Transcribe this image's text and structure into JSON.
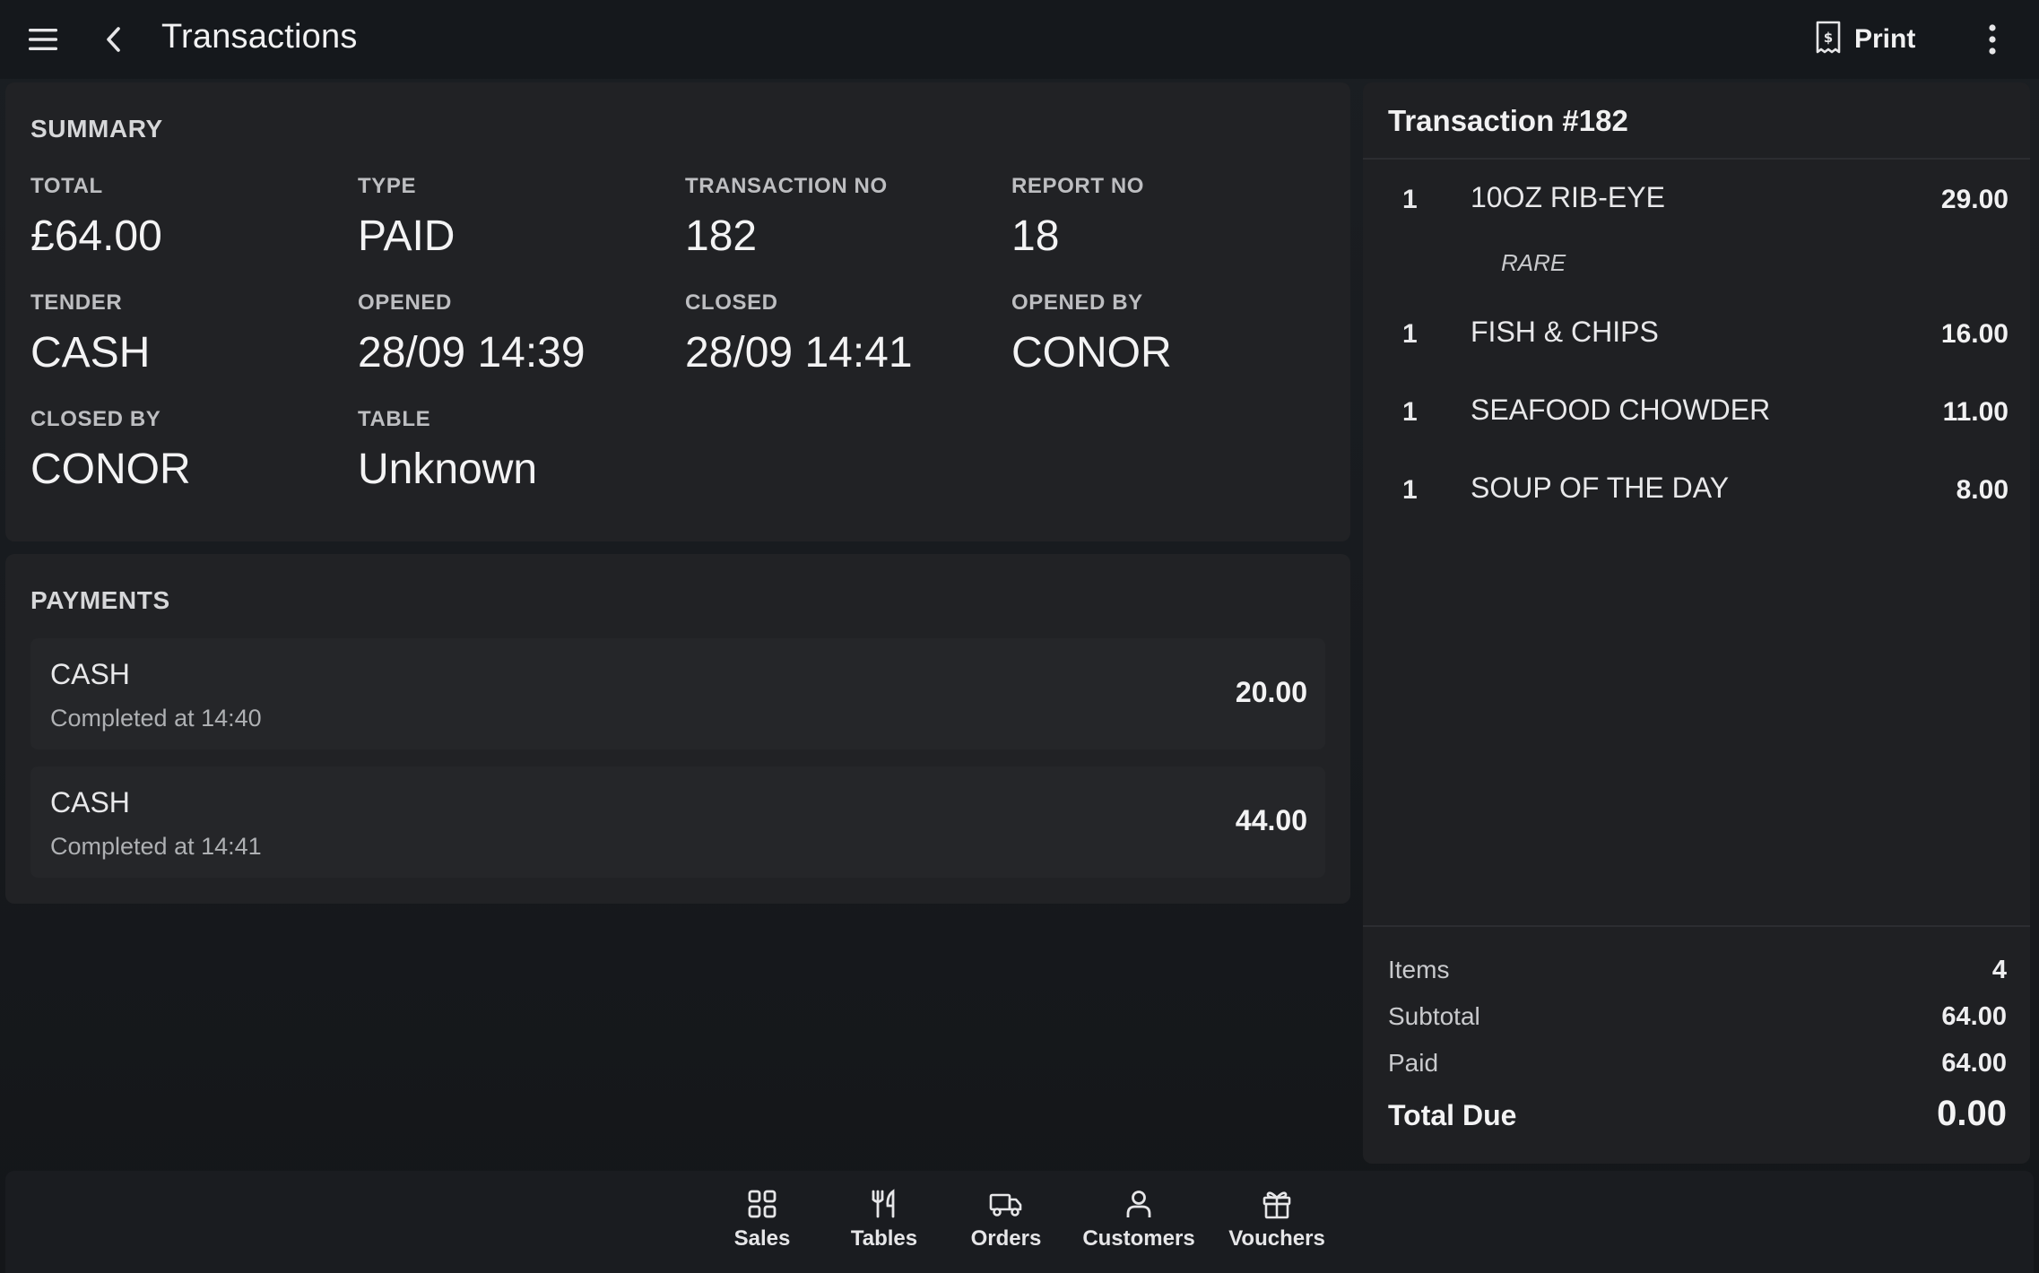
{
  "header": {
    "title": "Transactions",
    "print_label": "Print"
  },
  "summary": {
    "section_title": "SUMMARY",
    "fields": [
      {
        "label": "TOTAL",
        "value": "£64.00"
      },
      {
        "label": "TYPE",
        "value": "PAID"
      },
      {
        "label": "TRANSACTION NO",
        "value": "182"
      },
      {
        "label": "REPORT NO",
        "value": "18"
      },
      {
        "label": "TENDER",
        "value": "CASH"
      },
      {
        "label": "OPENED",
        "value": "28/09 14:39"
      },
      {
        "label": "CLOSED",
        "value": "28/09 14:41"
      },
      {
        "label": "OPENED BY",
        "value": "CONOR"
      },
      {
        "label": "CLOSED BY",
        "value": "CONOR"
      },
      {
        "label": "TABLE",
        "value": "Unknown"
      }
    ]
  },
  "payments": {
    "section_title": "PAYMENTS",
    "rows": [
      {
        "tender": "CASH",
        "status": "Completed at 14:40",
        "amount": "20.00"
      },
      {
        "tender": "CASH",
        "status": "Completed at 14:41",
        "amount": "44.00"
      }
    ]
  },
  "receipt": {
    "title": "Transaction #182",
    "items": [
      {
        "qty": "1",
        "name": "10OZ RIB-EYE",
        "price": "29.00",
        "modifier": "RARE"
      },
      {
        "qty": "1",
        "name": "FISH & CHIPS",
        "price": "16.00"
      },
      {
        "qty": "1",
        "name": "SEAFOOD CHOWDER",
        "price": "11.00"
      },
      {
        "qty": "1",
        "name": "SOUP OF THE DAY",
        "price": "8.00"
      }
    ],
    "totals": {
      "items_label": "Items",
      "items_value": "4",
      "subtotal_label": "Subtotal",
      "subtotal_value": "64.00",
      "paid_label": "Paid",
      "paid_value": "64.00",
      "total_due_label": "Total Due",
      "total_due_value": "0.00"
    }
  },
  "nav": {
    "items": [
      {
        "label": "Sales",
        "icon": "grid-icon"
      },
      {
        "label": "Tables",
        "icon": "cutlery-icon"
      },
      {
        "label": "Orders",
        "icon": "delivery-truck-icon"
      },
      {
        "label": "Customers",
        "icon": "person-icon"
      },
      {
        "label": "Vouchers",
        "icon": "gift-icon"
      }
    ]
  },
  "colors": {
    "background": "#171a1e",
    "card": "#212225",
    "text": "#e9e9ea",
    "muted": "#bdbec1"
  }
}
